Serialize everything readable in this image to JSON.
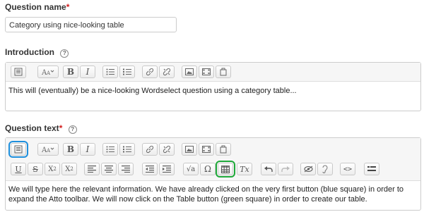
{
  "question_name": {
    "label": "Question name",
    "required_mark": "*",
    "value": "Category using nice-looking table"
  },
  "introduction": {
    "label": "Introduction",
    "help_icon": "question-circle-icon",
    "text": "This will (eventually) be a nice-looking Wordselect question using a category table...",
    "toolbar": {
      "buttons": [
        "show-more-icon",
        "font-size-icon",
        "bold-icon",
        "italic-icon",
        "unordered-list-icon",
        "ordered-list-icon",
        "link-icon",
        "unlink-icon",
        "image-icon",
        "media-icon",
        "file-icon"
      ],
      "bold": "B",
      "italic": "I"
    }
  },
  "question_text": {
    "label": "Question text",
    "required_mark": "*",
    "help_icon": "question-circle-icon",
    "text": "We will type here the relevant information. We have already clicked on the very first button (blue square) in order to expand the Atto toolbar. We will now click on the Table button (green square) in order to create our table.",
    "toolbar_row1": [
      "show-more-icon",
      "font-size-icon",
      "bold-icon",
      "italic-icon",
      "unordered-list-icon",
      "ordered-list-icon",
      "link-icon",
      "unlink-icon",
      "image-icon",
      "media-icon",
      "file-icon"
    ],
    "toolbar_row2": [
      "underline-icon",
      "strikethrough-icon",
      "subscript-icon",
      "superscript-icon",
      "align-left-icon",
      "align-center-icon",
      "align-right-icon",
      "outdent-icon",
      "indent-icon",
      "equation-icon",
      "special-char-icon",
      "table-icon",
      "clear-format-icon",
      "undo-icon",
      "redo-icon",
      "accessibility-checker-icon",
      "screenreader-helper-icon",
      "html-icon",
      "more-icon"
    ],
    "glyphs": {
      "bold": "B",
      "italic": "I",
      "underline": "U",
      "strike": "S",
      "sub_base": "X",
      "sub": "2",
      "sup_base": "X",
      "sup": "2",
      "sqrt": "√a",
      "omega": "Ω",
      "clear": "Tx",
      "code": "<>"
    }
  },
  "highlight_colors": {
    "blue": "#1f8fdc",
    "green": "#1fa93a"
  }
}
